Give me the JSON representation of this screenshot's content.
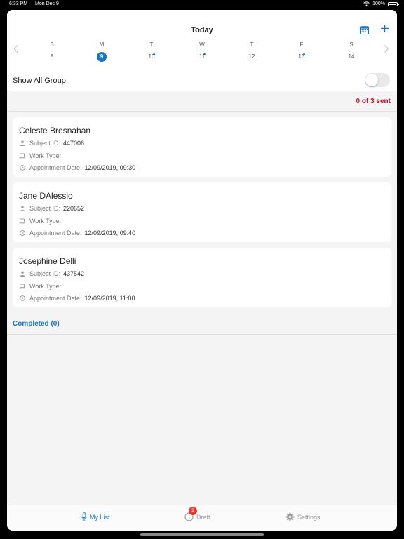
{
  "status_bar": {
    "time": "6:33 PM",
    "date": "Mon Dec 9",
    "battery": "100%"
  },
  "header": {
    "title": "Today",
    "icons": {
      "calendar": "calendar-icon",
      "add": "plus-icon",
      "prev": "chevron-left-icon",
      "next": "chevron-right-icon"
    },
    "week": [
      {
        "letter": "S",
        "num": "8",
        "selected": false,
        "dot": false
      },
      {
        "letter": "M",
        "num": "9",
        "selected": true,
        "dot": false
      },
      {
        "letter": "T",
        "num": "10",
        "selected": false,
        "dot": true
      },
      {
        "letter": "W",
        "num": "11",
        "selected": false,
        "dot": true
      },
      {
        "letter": "T",
        "num": "12",
        "selected": false,
        "dot": false
      },
      {
        "letter": "F",
        "num": "13",
        "selected": false,
        "dot": true
      },
      {
        "letter": "S",
        "num": "14",
        "selected": false,
        "dot": false
      }
    ]
  },
  "group_toggle": {
    "label": "Show All Group",
    "on": false
  },
  "sent_status": "0 of 3 sent",
  "labels": {
    "subject_id": "Subject ID:",
    "work_type": "Work Type:",
    "appointment_date": "Appointment Date:"
  },
  "appointments": [
    {
      "name": "Celeste Bresnahan",
      "subject_id": "447006",
      "work_type": "",
      "appointment_date": "12/09/2019, 09:30"
    },
    {
      "name": "Jane DAlessio",
      "subject_id": "220652",
      "work_type": "",
      "appointment_date": "12/09/2019, 09:40"
    },
    {
      "name": "Josephine Delli",
      "subject_id": "437542",
      "work_type": "",
      "appointment_date": "12/09/2019, 11:00"
    }
  ],
  "completed_label": "Completed (0)",
  "tabs": {
    "my_list": "My List",
    "draft": "Draft",
    "draft_badge": "1",
    "settings": "Settings"
  },
  "colors": {
    "accent": "#1777c9",
    "alert": "#c8102e",
    "badge": "#e53935"
  }
}
